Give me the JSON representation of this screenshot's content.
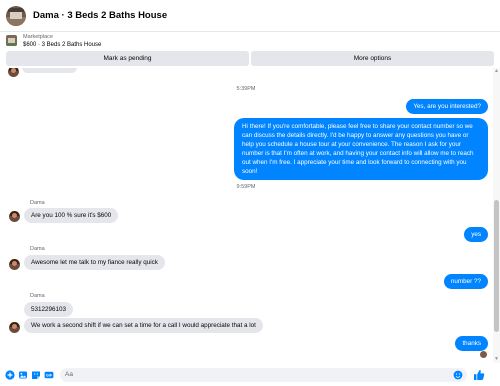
{
  "header": {
    "title": "Dama · 3 Beds 2 Baths House"
  },
  "listing": {
    "kicker": "Marketplace",
    "title": "$600 · 3 Beds 2 Baths House"
  },
  "actions": {
    "pending_label": "Mark as pending",
    "more_label": "More options"
  },
  "thread": {
    "timestamps": [
      "5:39PM",
      "9:59PM"
    ],
    "messages": [
      {
        "from": "me",
        "text": "Yes, are you interested?"
      },
      {
        "from": "me",
        "text": "Hi there! If you're comfortable, please feel free to share your contact number so we can discuss the details directly. I'd be happy to answer any questions you have or help you schedule a house tour at your convenience. The reason I ask for your number is that I'm often at work, and having your contact info will allow me to reach out when I'm free. I appreciate your time and look forward to connecting with you soon!"
      },
      {
        "from": "them",
        "sender": "Dama",
        "text": "Are you 100 % sure it's $600"
      },
      {
        "from": "me",
        "text": "yes"
      },
      {
        "from": "them",
        "sender": "Dama",
        "text": "Awesome let me talk to my fiance really quick"
      },
      {
        "from": "me",
        "text": "number ??"
      },
      {
        "from": "them",
        "sender": "Dama",
        "text": "5312296103"
      },
      {
        "from": "them",
        "text": "We work a second shift if we can set a time for a call I would appreciate that a lot"
      },
      {
        "from": "me",
        "text": "thanks"
      }
    ]
  },
  "composer": {
    "placeholder": "Aa"
  },
  "colors": {
    "accent": "#0084ff",
    "incoming_bubble": "#e4e6eb",
    "like": "#0084ff"
  },
  "icons": [
    "plus-circle-icon",
    "photo-icon",
    "sticker-icon",
    "gif-icon",
    "emoji-icon",
    "like-thumb-icon"
  ]
}
